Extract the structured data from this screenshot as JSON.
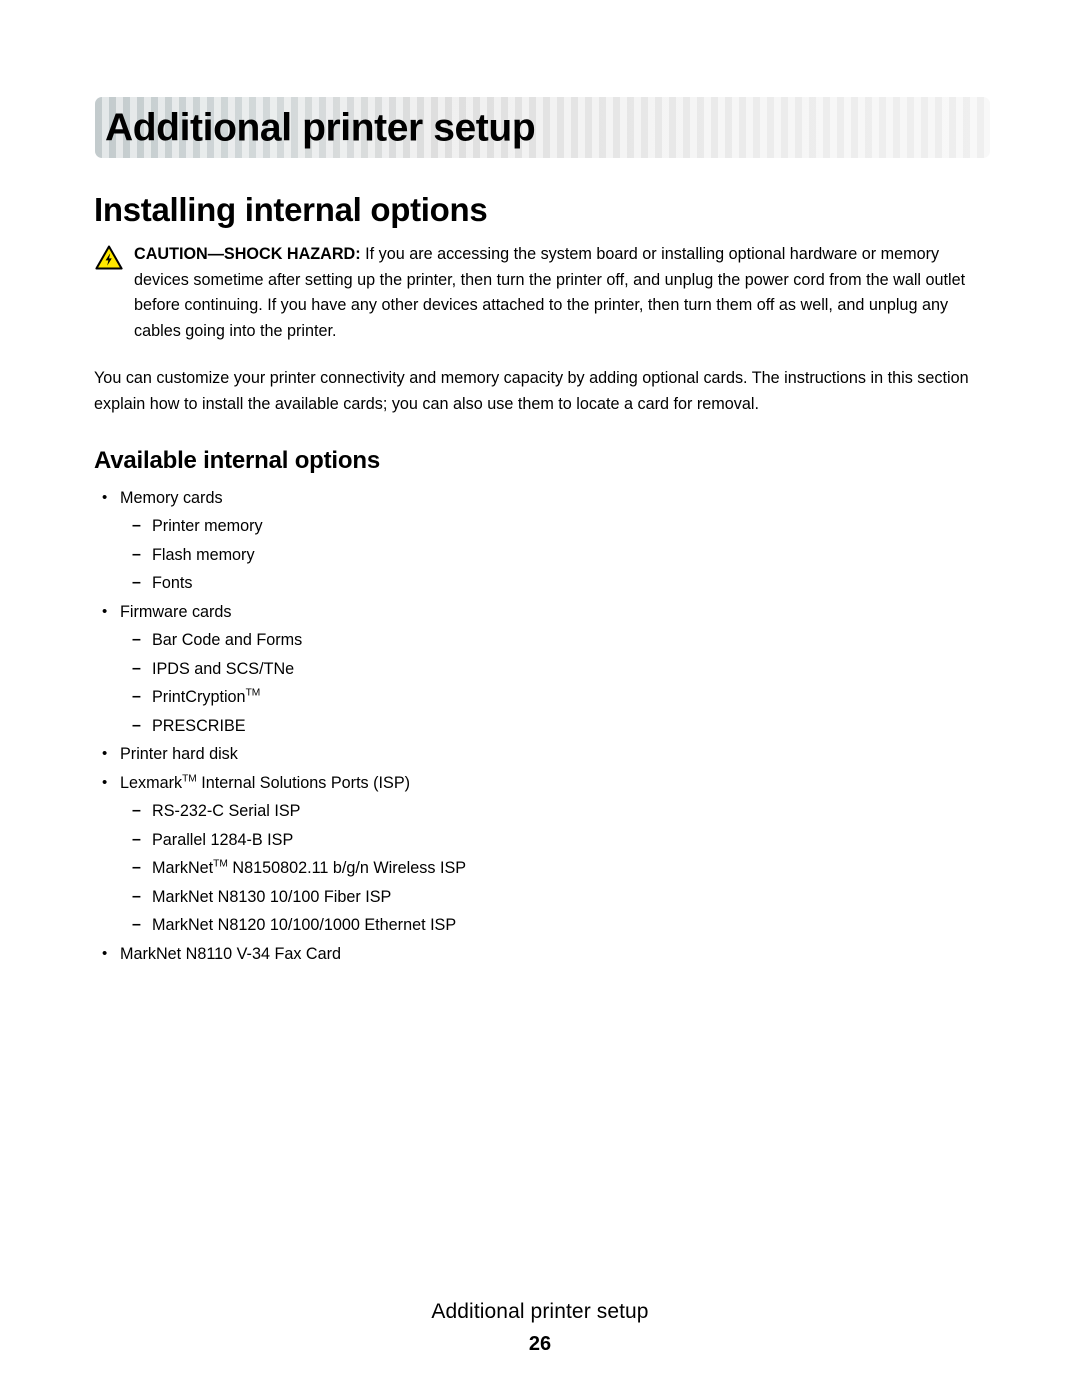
{
  "banner": {
    "chapter_title": "Additional printer setup",
    "bg_gradient_start": "#c3cbcd",
    "bg_gradient_end": "#efefef"
  },
  "section": {
    "title": "Installing internal options"
  },
  "caution": {
    "icon": "electrical-shock-hazard-triangle-icon",
    "icon_fill": "#ffe800",
    "icon_stroke": "#000000",
    "label": "CAUTION—SHOCK HAZARD:",
    "body": " If you are accessing the system board or installing optional hardware or memory devices sometime after setting up the printer, then turn the printer off, and unplug the power cord from the wall outlet before continuing. If you have any other devices attached to the printer, then turn them off as well, and unplug any cables going into the printer."
  },
  "intro": {
    "paragraph": "You can customize your printer connectivity and memory capacity by adding optional cards. The instructions in this section explain how to install the available cards; you can also use them to locate a card for removal."
  },
  "available_options": {
    "heading": "Available internal options",
    "bullet_glyph": "•",
    "dash_glyph": "–",
    "items": [
      {
        "level": 1,
        "text": "Memory cards"
      },
      {
        "level": 2,
        "text": "Printer memory"
      },
      {
        "level": 2,
        "text": "Flash memory"
      },
      {
        "level": 2,
        "text": "Fonts"
      },
      {
        "level": 1,
        "text": "Firmware cards"
      },
      {
        "level": 2,
        "text": "Bar Code and Forms"
      },
      {
        "level": 2,
        "text": "IPDS and SCS/TNe"
      },
      {
        "level": 2,
        "text": "PrintCryption",
        "sup": "TM",
        "after": ""
      },
      {
        "level": 2,
        "text": "PRESCRIBE"
      },
      {
        "level": 1,
        "text": "Printer hard disk"
      },
      {
        "level": 1,
        "text": "Lexmark",
        "sup": "TM",
        "after": " Internal Solutions Ports (ISP)"
      },
      {
        "level": 2,
        "text": "RS-232-C Serial ISP"
      },
      {
        "level": 2,
        "text": "Parallel 1284-B ISP"
      },
      {
        "level": 2,
        "text": "MarkNet",
        "sup": "TM",
        "after": " N8150802.11 b/g/n Wireless ISP"
      },
      {
        "level": 2,
        "text": "MarkNet N8130 10/100 Fiber ISP"
      },
      {
        "level": 2,
        "text": "MarkNet N8120 10/100/1000 Ethernet ISP"
      },
      {
        "level": 1,
        "text": "MarkNet N8110 V-34 Fax Card"
      }
    ]
  },
  "footer": {
    "running_title": "Additional printer setup",
    "page_number": "26"
  }
}
